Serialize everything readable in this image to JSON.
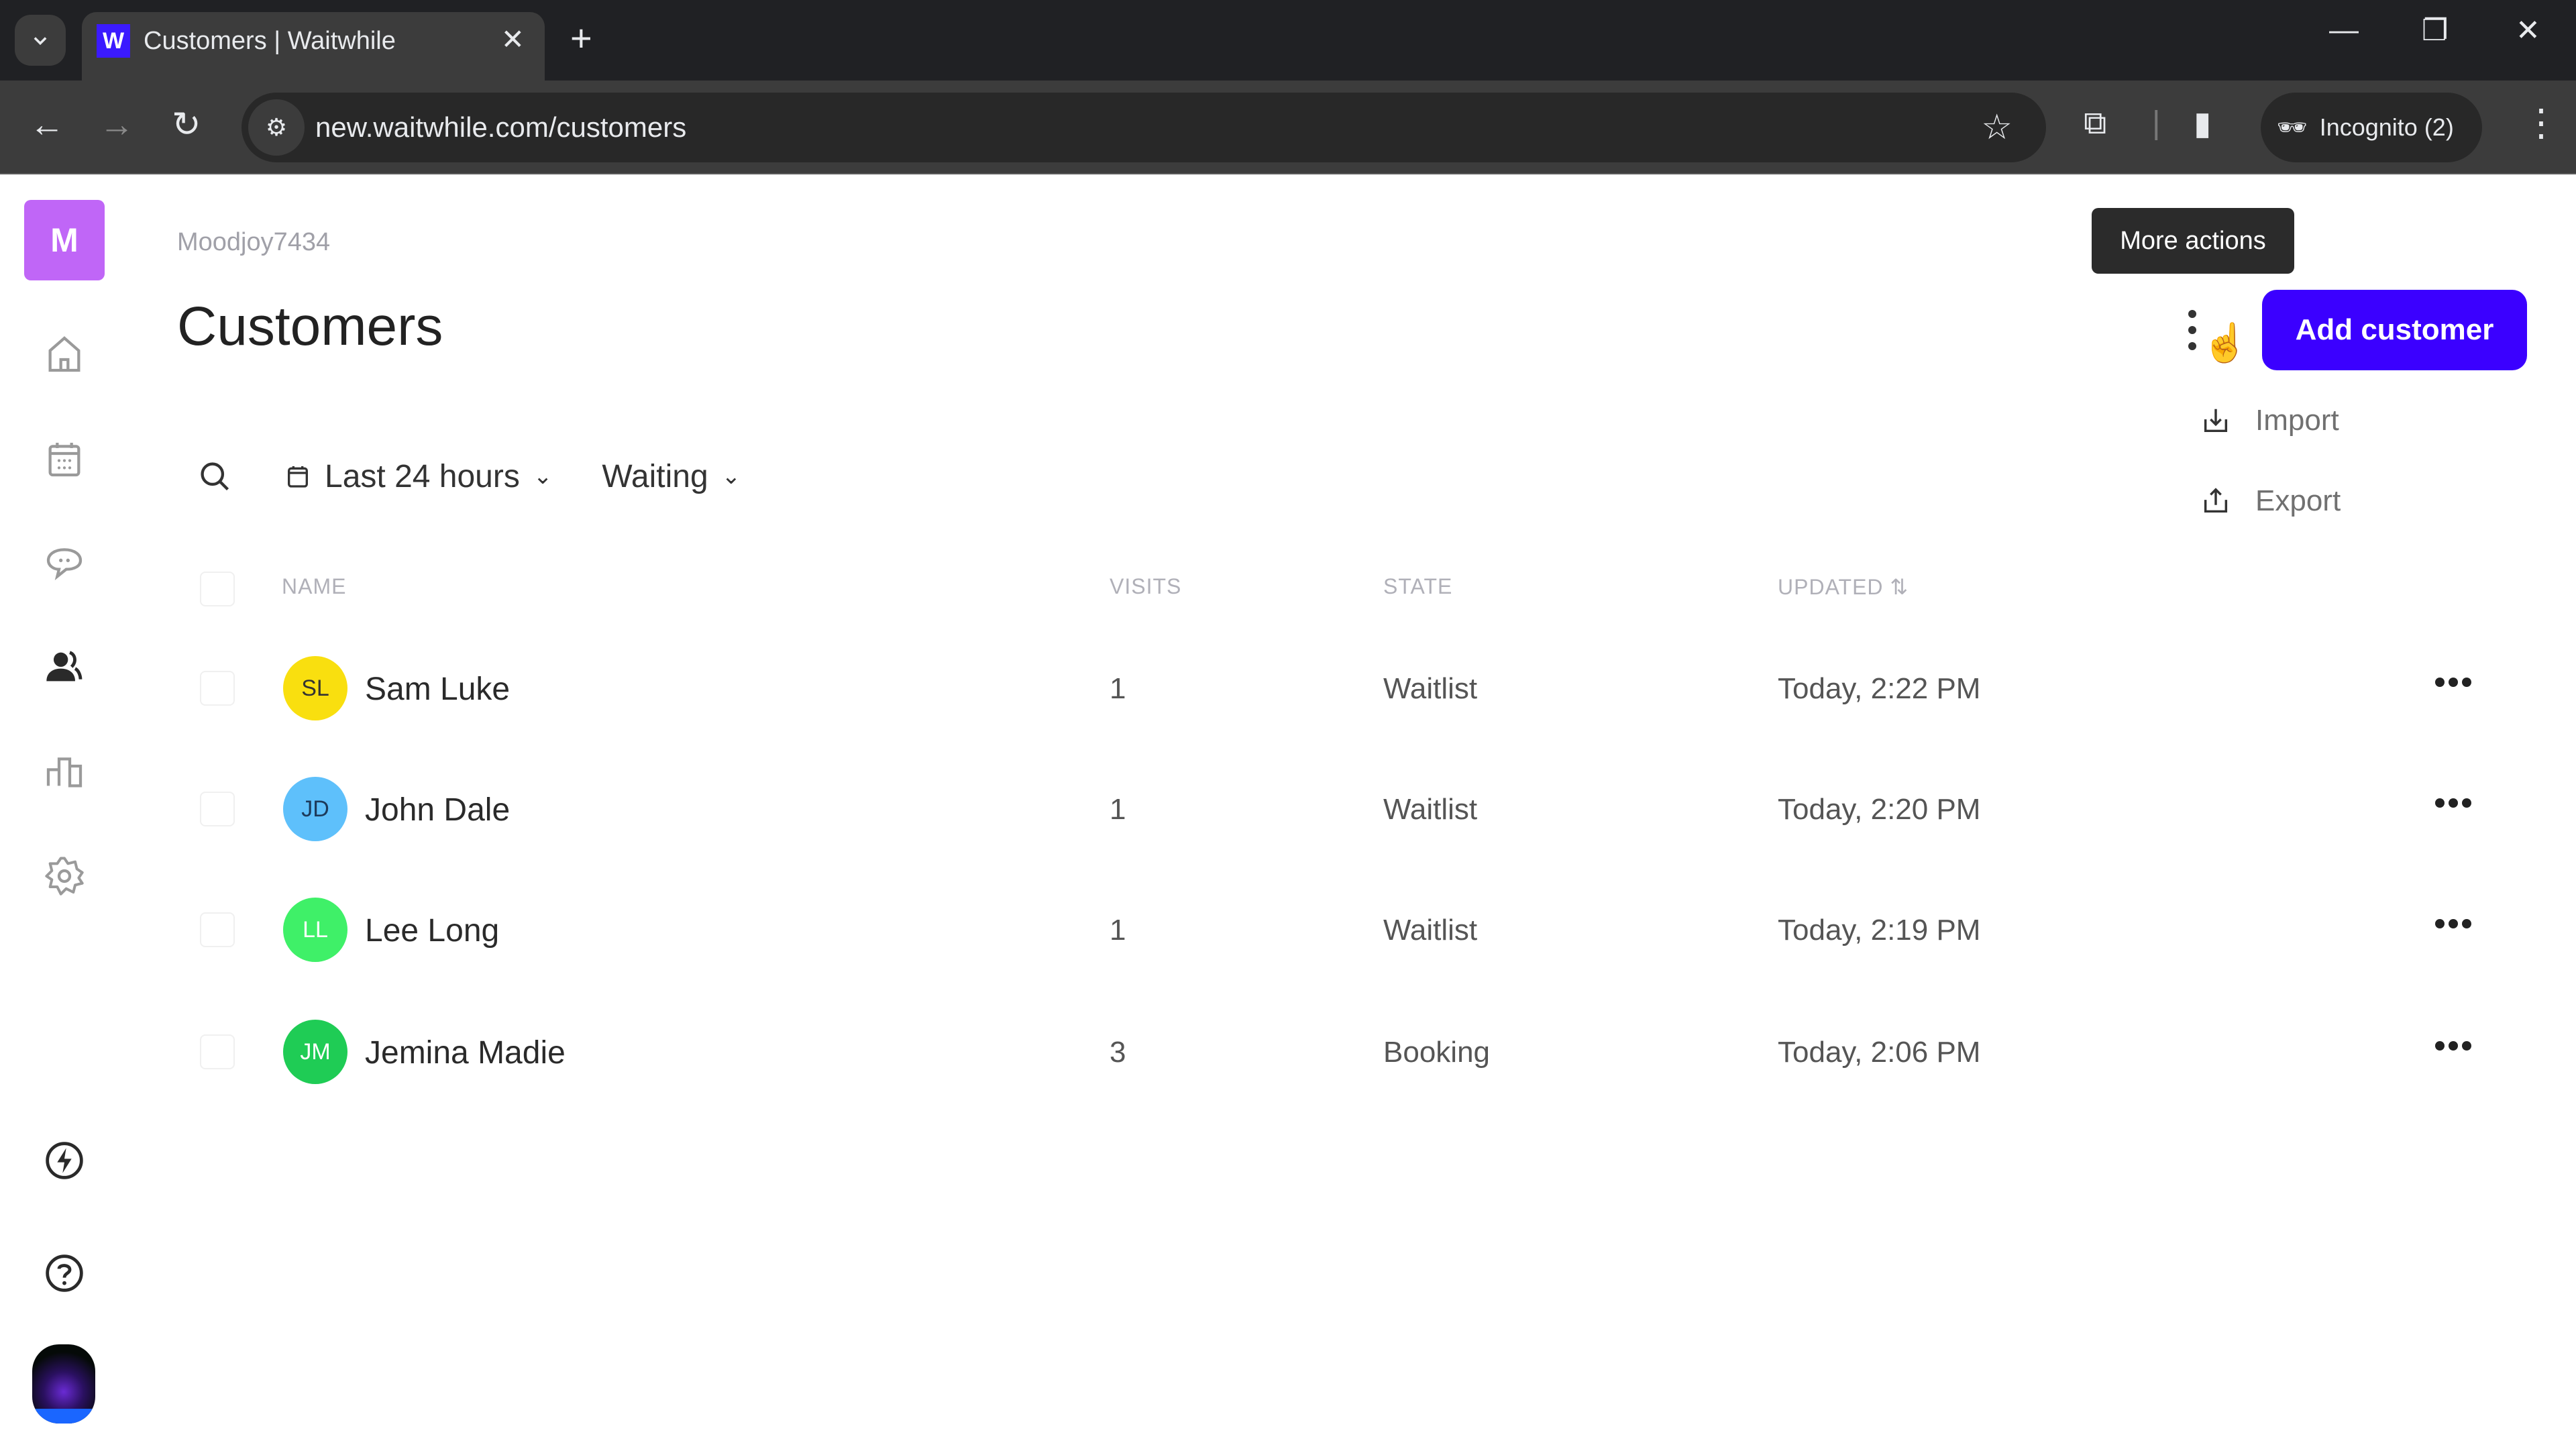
{
  "browser": {
    "tab_title": "Customers | Waitwhile",
    "favicon_letter": "W",
    "url": "new.waitwhile.com/customers",
    "incognito_label": "Incognito (2)"
  },
  "sidebar": {
    "logo_letter": "M",
    "items": [
      {
        "name": "home"
      },
      {
        "name": "calendar"
      },
      {
        "name": "messages"
      },
      {
        "name": "customers",
        "active": true
      },
      {
        "name": "analytics"
      },
      {
        "name": "settings"
      }
    ],
    "bottom": [
      {
        "name": "whats-new"
      },
      {
        "name": "help"
      },
      {
        "name": "profile"
      }
    ]
  },
  "header": {
    "account": "Moodjoy7434",
    "title": "Customers",
    "tooltip": "More actions",
    "add_button": "Add customer",
    "menu": [
      {
        "label": "Import",
        "icon": "import-icon"
      },
      {
        "label": "Export",
        "icon": "export-icon"
      }
    ]
  },
  "filters": {
    "date_range": "Last 24 hours",
    "status": "Waiting"
  },
  "table": {
    "columns": {
      "name": "NAME",
      "visits": "VISITS",
      "state": "STATE",
      "updated": "UPDATED ⇅"
    },
    "rows": [
      {
        "initials": "SL",
        "name": "Sam Luke",
        "visits": "1",
        "state": "Waitlist",
        "updated": "Today, 2:22 PM",
        "avatar_color": "#f9df0f",
        "initials_color": "#333333"
      },
      {
        "initials": "JD",
        "name": "John Dale",
        "visits": "1",
        "state": "Waitlist",
        "updated": "Today, 2:20 PM",
        "avatar_color": "#5ec0fb",
        "initials_color": "#1d3a5a"
      },
      {
        "initials": "LL",
        "name": "Lee Long",
        "visits": "1",
        "state": "Waitlist",
        "updated": "Today, 2:19 PM",
        "avatar_color": "#3ff068",
        "initials_color": "#ffffff"
      },
      {
        "initials": "JM",
        "name": "Jemina Madie",
        "visits": "3",
        "state": "Booking",
        "updated": "Today, 2:06 PM",
        "avatar_color": "#1fcc55",
        "initials_color": "#ffffff"
      }
    ]
  },
  "colors": {
    "brand": "#3b00ff",
    "logo": "#c066f7"
  }
}
